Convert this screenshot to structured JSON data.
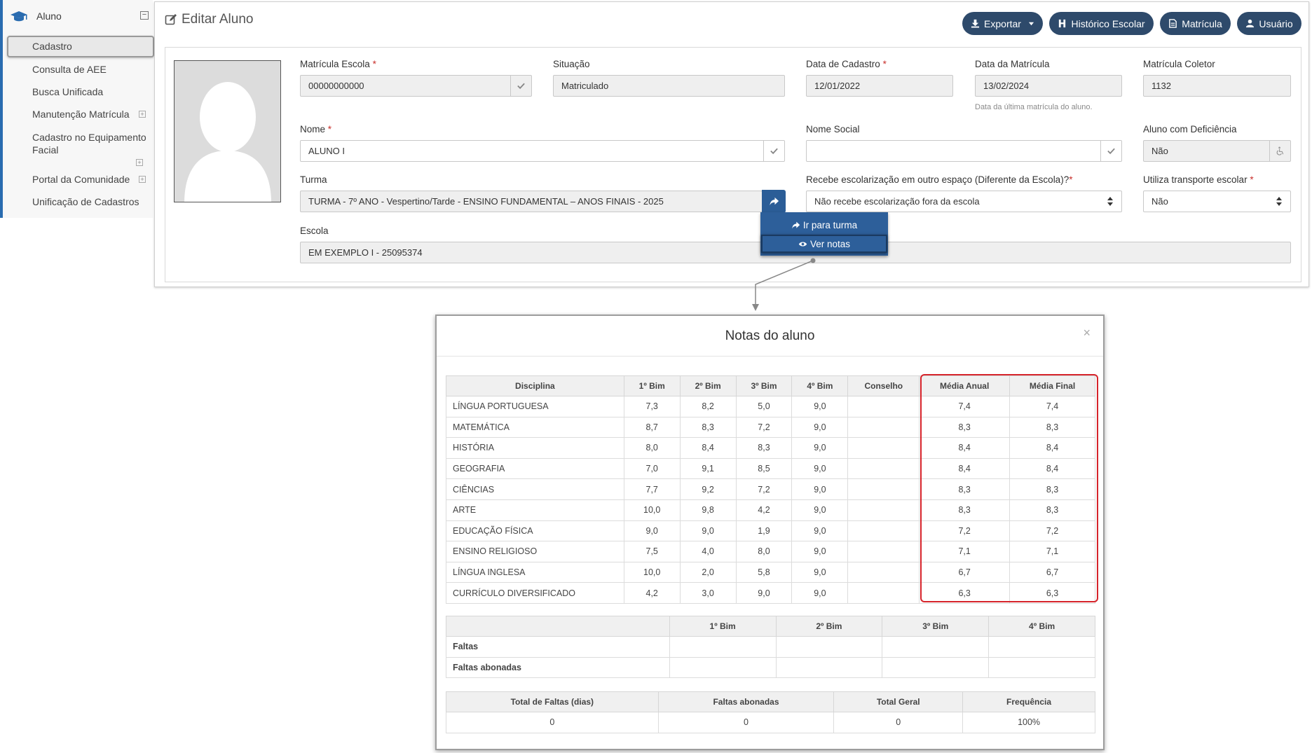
{
  "sidebar": {
    "section": "Aluno",
    "toggle": "⊟",
    "items": [
      {
        "label": "Cadastro"
      },
      {
        "label": "Consulta de AEE"
      },
      {
        "label": "Busca Unificada"
      },
      {
        "label": "Manutenção Matrícula"
      },
      {
        "label": "Cadastro no Equipamento Facial"
      },
      {
        "label": "Portal da Comunidade"
      },
      {
        "label": "Unificação de Cadastros"
      }
    ]
  },
  "header": {
    "title": "Editar Aluno",
    "buttons": {
      "exportar": "Exportar",
      "historico": "Histórico Escolar",
      "matricula": "Matrícula",
      "usuario": "Usuário"
    }
  },
  "form": {
    "matricula_escola": {
      "label": "Matrícula Escola",
      "value": "00000000000"
    },
    "situacao": {
      "label": "Situação",
      "value": "Matriculado"
    },
    "data_cadastro": {
      "label": "Data de Cadastro",
      "value": "12/01/2022"
    },
    "data_matricula": {
      "label": "Data da Matrícula",
      "value": "13/02/2024",
      "hint": "Data da última matrícula do aluno."
    },
    "matricula_coletor": {
      "label": "Matrícula Coletor",
      "value": "1132"
    },
    "nome": {
      "label": "Nome",
      "value": "ALUNO I"
    },
    "nome_social": {
      "label": "Nome Social",
      "value": ""
    },
    "deficiencia": {
      "label": "Aluno com Deficiência",
      "value": "Não"
    },
    "turma": {
      "label": "Turma",
      "value": "TURMA - 7º ANO - Vespertino/Tarde - ENSINO FUNDAMENTAL – ANOS FINAIS - 2025"
    },
    "escolarizacao": {
      "label": "Recebe escolarização em outro espaço (Diferente da Escola)?",
      "value": "Não recebe escolarização fora da escola"
    },
    "transporte": {
      "label": "Utiliza transporte escolar",
      "value": "Não"
    },
    "escola": {
      "label": "Escola",
      "value": "EM EXEMPLO I - 25095374"
    },
    "required_mark": "*"
  },
  "turma_menu": {
    "items": [
      "Ir para turma",
      "Ver notas"
    ],
    "selected": "Ver notas"
  },
  "modal": {
    "title": "Notas do aluno",
    "close": "×",
    "grades": {
      "headers": [
        "Disciplina",
        "1º Bim",
        "2º Bim",
        "3º Bim",
        "4º Bim",
        "Conselho",
        "Média Anual",
        "Média Final"
      ],
      "rows": [
        [
          "LÍNGUA PORTUGUESA",
          "7,3",
          "8,2",
          "5,0",
          "9,0",
          "",
          "7,4",
          "7,4"
        ],
        [
          "MATEMÁTICA",
          "8,7",
          "8,3",
          "7,2",
          "9,0",
          "",
          "8,3",
          "8,3"
        ],
        [
          "HISTÓRIA",
          "8,0",
          "8,4",
          "8,3",
          "9,0",
          "",
          "8,4",
          "8,4"
        ],
        [
          "GEOGRAFIA",
          "7,0",
          "9,1",
          "8,5",
          "9,0",
          "",
          "8,4",
          "8,4"
        ],
        [
          "CIÊNCIAS",
          "7,7",
          "9,2",
          "7,2",
          "9,0",
          "",
          "8,3",
          "8,3"
        ],
        [
          "ARTE",
          "10,0",
          "9,8",
          "4,2",
          "9,0",
          "",
          "8,3",
          "8,3"
        ],
        [
          "EDUCAÇÃO FÍSICA",
          "9,0",
          "9,0",
          "1,9",
          "9,0",
          "",
          "7,2",
          "7,2"
        ],
        [
          "ENSINO RELIGIOSO",
          "7,5",
          "4,0",
          "8,0",
          "9,0",
          "",
          "7,1",
          "7,1"
        ],
        [
          "LÍNGUA INGLESA",
          "10,0",
          "2,0",
          "5,8",
          "9,0",
          "",
          "6,7",
          "6,7"
        ],
        [
          "CURRÍCULO DIVERSIFICADO",
          "4,2",
          "3,0",
          "9,0",
          "9,0",
          "",
          "6,3",
          "6,3"
        ]
      ]
    },
    "faltas": {
      "headers": [
        "",
        "1º Bim",
        "2º Bim",
        "3º Bim",
        "4º Bim"
      ],
      "rows": [
        [
          "Faltas",
          "",
          "",
          "",
          ""
        ],
        [
          "Faltas abonadas",
          "",
          "",
          "",
          ""
        ]
      ]
    },
    "totais": {
      "headers": [
        "Total de Faltas (dias)",
        "Faltas abonadas",
        "Total Geral",
        "Frequência"
      ],
      "values": [
        "0",
        "0",
        "0",
        "100%"
      ]
    }
  },
  "colors": {
    "sidebar_accent": "#2a6cb0",
    "button_dark": "#2e4a6b",
    "menu_blue": "#2d5f9a",
    "highlight_red": "#d6242b"
  }
}
